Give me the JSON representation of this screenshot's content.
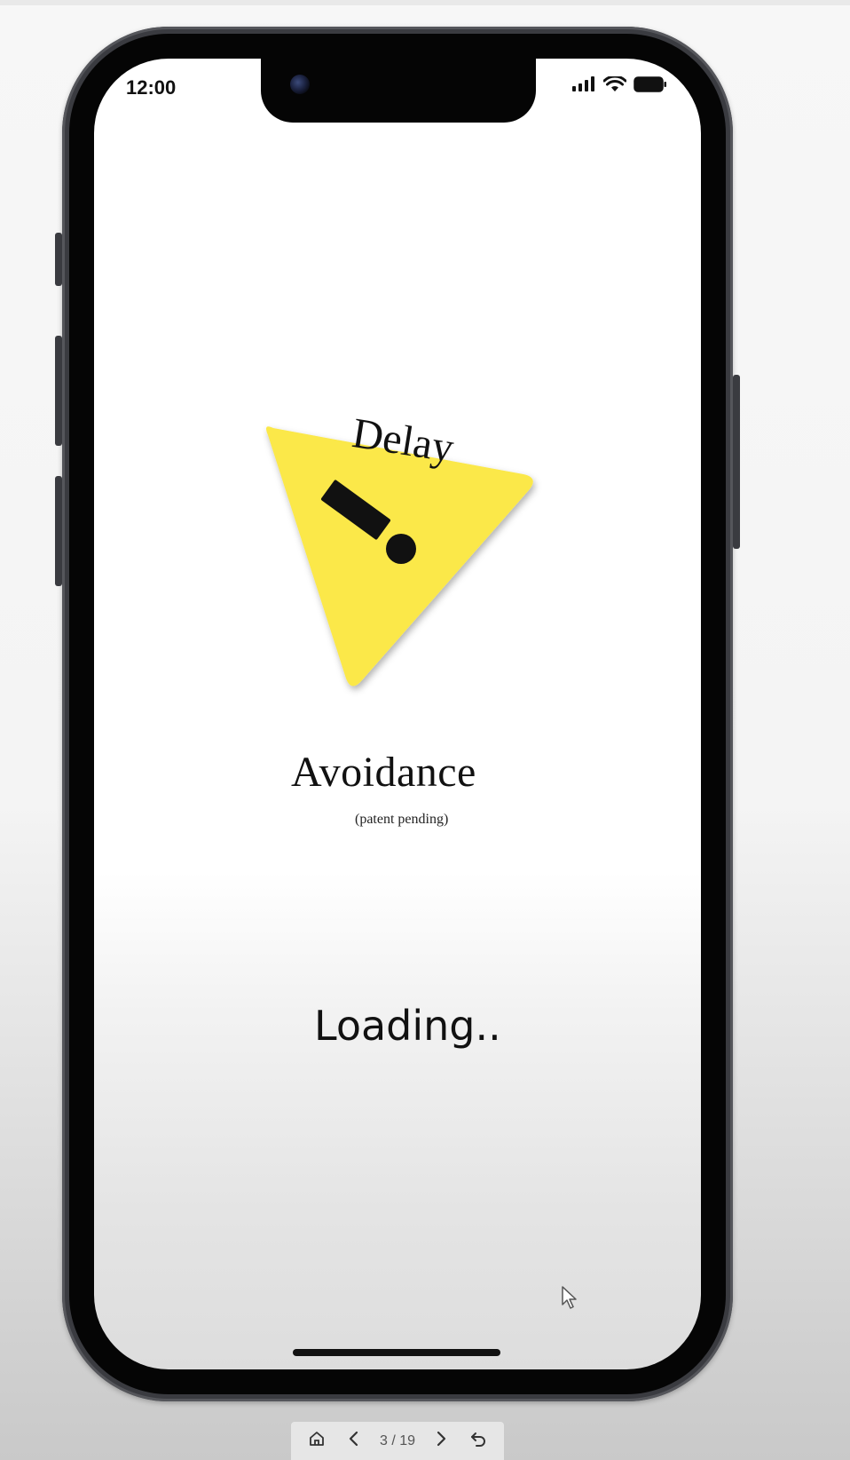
{
  "status_bar": {
    "time": "12:00",
    "icons": [
      "cellular-signal-icon",
      "wifi-icon",
      "battery-icon"
    ]
  },
  "splash": {
    "title_top": "Delay",
    "title_bottom": "Avoidance",
    "subtitle": "(patent pending)",
    "loading": "Loading..",
    "logo_icon": "warning-triangle-icon",
    "logo_color": "#fbe84a"
  },
  "pres_toolbar": {
    "home_icon": "home-icon",
    "prev_icon": "chevron-left-icon",
    "page": "3 / 19",
    "next_icon": "chevron-right-icon",
    "restart_icon": "undo-icon"
  }
}
